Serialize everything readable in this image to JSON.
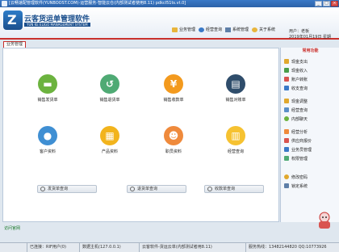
{
  "window": {
    "title": "[云畅速配管理软件(YUNBOOST.COM)-运营服务-智能云仓(内部测试者使用8.11)   pdkcl51ts.vt.0]"
  },
  "header": {
    "brand_cn": "云客货运单管理软件",
    "brand_en": "YUN KE ELIGO MANAGEMENT SYSTEM",
    "toolbar": [
      "业务管理",
      "经营查询",
      "系统管理",
      "关于系统"
    ],
    "user_line1": "用户：老板",
    "user_line2": "2019年01月19日 星期"
  },
  "tabs": {
    "active": "业务管理"
  },
  "functions": [
    {
      "label": "销售发货单",
      "icon": "truck-icon"
    },
    {
      "label": "销售退货单",
      "icon": "return-icon"
    },
    {
      "label": "销售收款单",
      "icon": "yen-icon"
    },
    {
      "label": "销售对账单",
      "icon": "ledger-icon"
    },
    {
      "label": "客户资料",
      "icon": "customer-icon"
    },
    {
      "label": "产品资料",
      "icon": "product-icon"
    },
    {
      "label": "职员资料",
      "icon": "staff-icon"
    },
    {
      "label": "经营查询",
      "icon": "chart-icon"
    }
  ],
  "query_bar": [
    "发货单查询",
    "退货单查询",
    "收款单查询"
  ],
  "sidebar": {
    "title": "常用功能",
    "items": [
      "现金支出",
      "现金收入",
      "账户转账",
      "收支查询",
      "现金调整",
      "经营查询",
      "内部聊天",
      "经营分析",
      "供应商报价",
      "业务员管理",
      "权限管理",
      "修改密码",
      "锁定系统"
    ]
  },
  "status_link": "访问官网",
  "statusbar": {
    "section1": "",
    "section2": "已连接：RIF用户(0)",
    "section3": "数据主机(127.0.0.1)",
    "section4": "云客软件-货运云单(内部测试者用8.11)",
    "section5": "服务热线：13482144820 QQ:10773926"
  }
}
